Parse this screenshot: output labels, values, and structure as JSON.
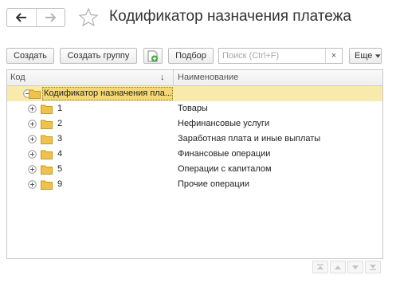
{
  "window": {
    "title": "Кодификатор назначения платежа"
  },
  "toolbar": {
    "create_label": "Создать",
    "create_group_label": "Создать группу",
    "selection_label": "Подбор",
    "search_placeholder": "Поиск (Ctrl+F)",
    "search_clear": "×",
    "more_label": "Еще"
  },
  "table": {
    "columns": {
      "code": "Код",
      "sort_indicator": "↓",
      "name": "Наименование"
    },
    "root": {
      "code": "Кодификатор назначения пла...",
      "name": ""
    },
    "rows": [
      {
        "code": "1",
        "name": "Товары"
      },
      {
        "code": "2",
        "name": "Нефинансовые услуги"
      },
      {
        "code": "3",
        "name": "Заработная плата и иные выплаты"
      },
      {
        "code": "4",
        "name": "Финансовые операции"
      },
      {
        "code": "5",
        "name": "Операции с капиталом"
      },
      {
        "code": "9",
        "name": "Прочие операции"
      }
    ]
  },
  "colors": {
    "accent_selected_row": "#f7eaaa",
    "selected_cell": "#f5d872",
    "folder": "#f0c24b",
    "create_item_icon": "#3aa63a"
  },
  "icons": {
    "back": "arrow-left-icon",
    "forward": "arrow-right-icon",
    "favorite": "star-icon",
    "create_item": "create-item-icon",
    "dropdown": "chevron-down-icon",
    "expand": "plus-circle-icon",
    "collapse": "minus-circle-icon",
    "folder": "folder-icon"
  }
}
